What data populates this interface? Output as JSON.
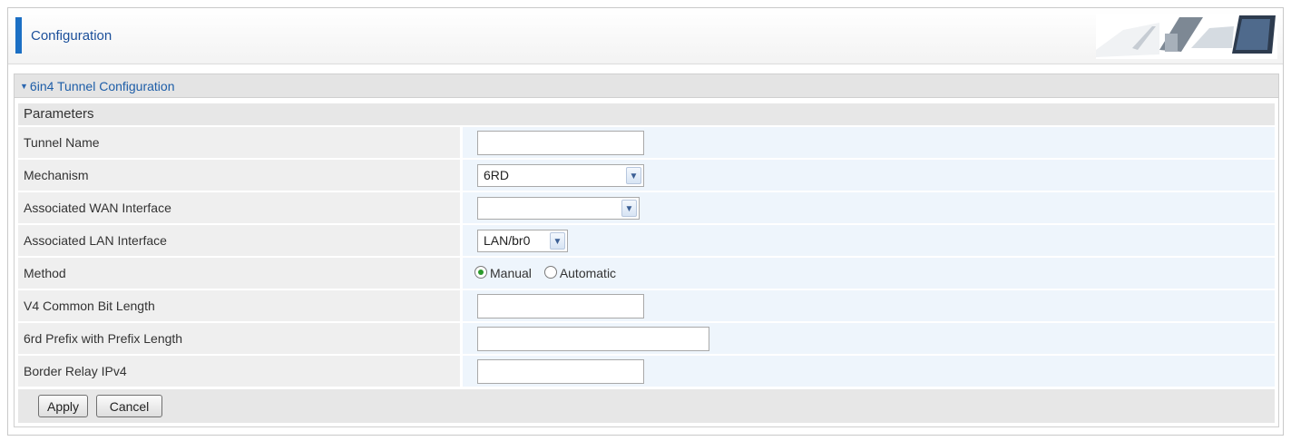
{
  "header": {
    "title": "Configuration"
  },
  "section": {
    "title": "6in4 Tunnel Configuration",
    "expand_icon": "triangle-down-icon"
  },
  "params": {
    "heading": "Parameters",
    "tunnel_name": {
      "label": "Tunnel Name",
      "value": ""
    },
    "mechanism": {
      "label": "Mechanism",
      "value": "6RD"
    },
    "wan_interface": {
      "label": "Associated WAN Interface",
      "value": ""
    },
    "lan_interface": {
      "label": "Associated LAN Interface",
      "value": "LAN/br0"
    },
    "method": {
      "label": "Method",
      "options": [
        "Manual",
        "Automatic"
      ],
      "selected": "Manual"
    },
    "v4_common_bit_length": {
      "label": "V4 Common Bit Length",
      "value": ""
    },
    "prefix_6rd": {
      "label": "6rd Prefix with Prefix Length",
      "value": ""
    },
    "border_relay": {
      "label": "Border Relay IPv4",
      "value": ""
    }
  },
  "buttons": {
    "apply": "Apply",
    "cancel": "Cancel"
  },
  "colors": {
    "accent": "#1b6fc4",
    "link": "#1e5ea8",
    "value_bg": "#eef5fc",
    "label_bg": "#efefef"
  }
}
